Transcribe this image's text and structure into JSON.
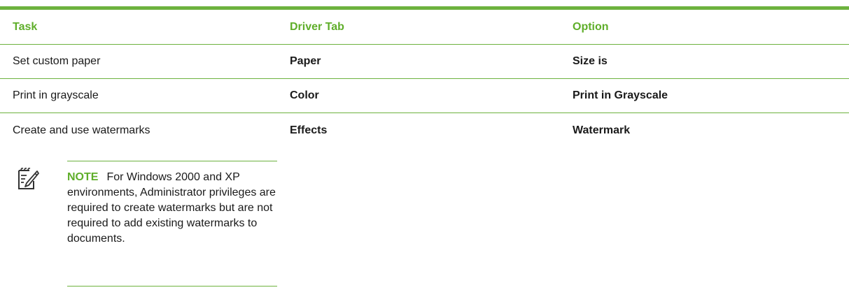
{
  "table": {
    "headers": [
      "Task",
      "Driver Tab",
      "Option"
    ],
    "rows": [
      {
        "task": "Set custom paper",
        "tab": "Paper",
        "option": "Size is"
      },
      {
        "task": "Print in grayscale",
        "tab": "Color",
        "option": "Print in Grayscale"
      },
      {
        "task": "Create and use watermarks",
        "tab": "Effects",
        "option": "Watermark"
      }
    ]
  },
  "note": {
    "label": "NOTE",
    "text": "For Windows 2000 and XP environments, Administrator privileges are required to create watermarks but are not required to add existing watermarks to documents.",
    "icon": "note-pencil-icon"
  },
  "colors": {
    "accent": "#6db23e",
    "heading": "#5fae2a",
    "text": "#1a1a1a"
  }
}
